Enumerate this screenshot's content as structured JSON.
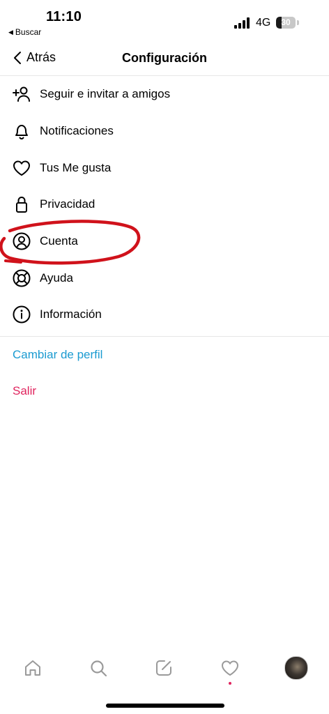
{
  "status_bar": {
    "time": "11:10",
    "back_app": "Buscar",
    "network": "4G",
    "battery_percent": "30",
    "battery_level": 0.3
  },
  "header": {
    "back_label": "Atrás",
    "title": "Configuración"
  },
  "settings_items": [
    {
      "label": "Seguir e invitar a amigos",
      "icon": "add-person-icon"
    },
    {
      "label": "Notificaciones",
      "icon": "bell-icon"
    },
    {
      "label": "Tus Me gusta",
      "icon": "heart-icon"
    },
    {
      "label": "Privacidad",
      "icon": "lock-icon"
    },
    {
      "label": "Cuenta",
      "icon": "user-circle-icon"
    },
    {
      "label": "Ayuda",
      "icon": "lifebuoy-icon"
    },
    {
      "label": "Información",
      "icon": "info-icon"
    }
  ],
  "links": {
    "switch_profile": {
      "label": "Cambiar de perfil",
      "color": "#1b9bd1"
    },
    "logout": {
      "label": "Salir",
      "color": "#e0245e"
    }
  },
  "tab_bar": {
    "tabs": [
      "home-icon",
      "search-icon",
      "compose-icon",
      "activity-heart-icon",
      "profile-avatar"
    ],
    "notification_dot_color": "#e0245e"
  },
  "annotation_color": "#d0121b"
}
